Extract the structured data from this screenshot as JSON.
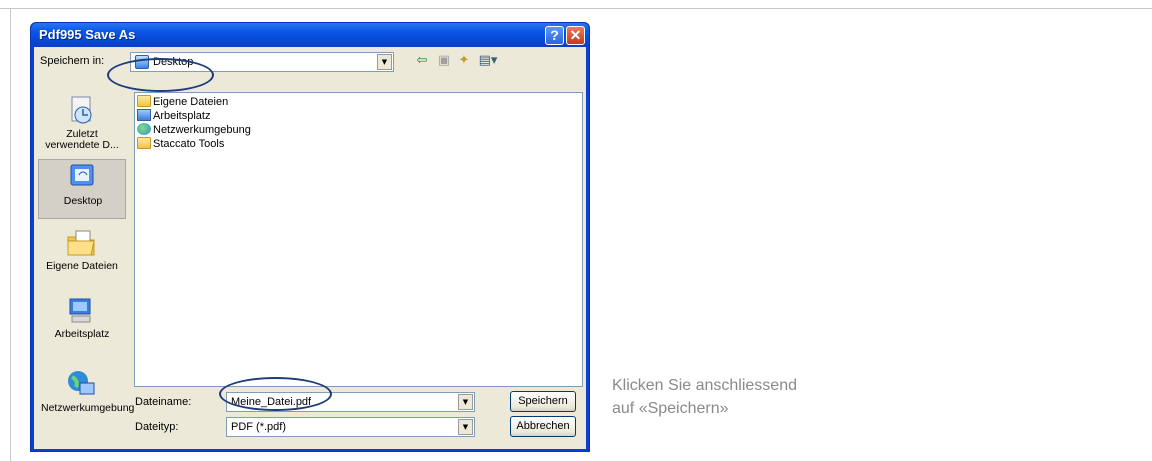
{
  "dialog": {
    "title": "Pdf995 Save As",
    "help_symbol": "?",
    "close_symbol": "✕",
    "save_in_label": "Speichern in:",
    "save_in_value": "Desktop",
    "toolbar_icons": [
      "back-arrow-icon",
      "up-folder-icon",
      "new-folder-icon",
      "view-menu-icon"
    ]
  },
  "places": [
    {
      "label": "Zuletzt verwendete D...",
      "icon": "recent-documents-icon"
    },
    {
      "label": "Desktop",
      "icon": "desktop-icon"
    },
    {
      "label": "Eigene Dateien",
      "icon": "my-documents-icon"
    },
    {
      "label": "Arbeitsplatz",
      "icon": "my-computer-icon"
    },
    {
      "label": "Netzwerkumgebung",
      "icon": "network-icon"
    }
  ],
  "files": [
    {
      "name": "Eigene Dateien",
      "icon": "folder-icon"
    },
    {
      "name": "Arbeitsplatz",
      "icon": "computer-icon"
    },
    {
      "name": "Netzwerkumgebung",
      "icon": "network-icon"
    },
    {
      "name": "Staccato Tools",
      "icon": "folder-icon"
    }
  ],
  "filename": {
    "label": "Dateiname:",
    "value": "Meine_Datei.pdf"
  },
  "filetype": {
    "label": "Dateityp:",
    "value": "PDF (*.pdf)"
  },
  "buttons": {
    "save": "Speichern",
    "cancel": "Abbrechen"
  },
  "instruction": {
    "line1": "Klicken Sie anschliessend",
    "line2": "auf «Speichern»"
  },
  "colors": {
    "titlebar": "#0a55e6",
    "highlight_ring": "#1c3d79",
    "instruction_text": "#8a8a8a"
  }
}
